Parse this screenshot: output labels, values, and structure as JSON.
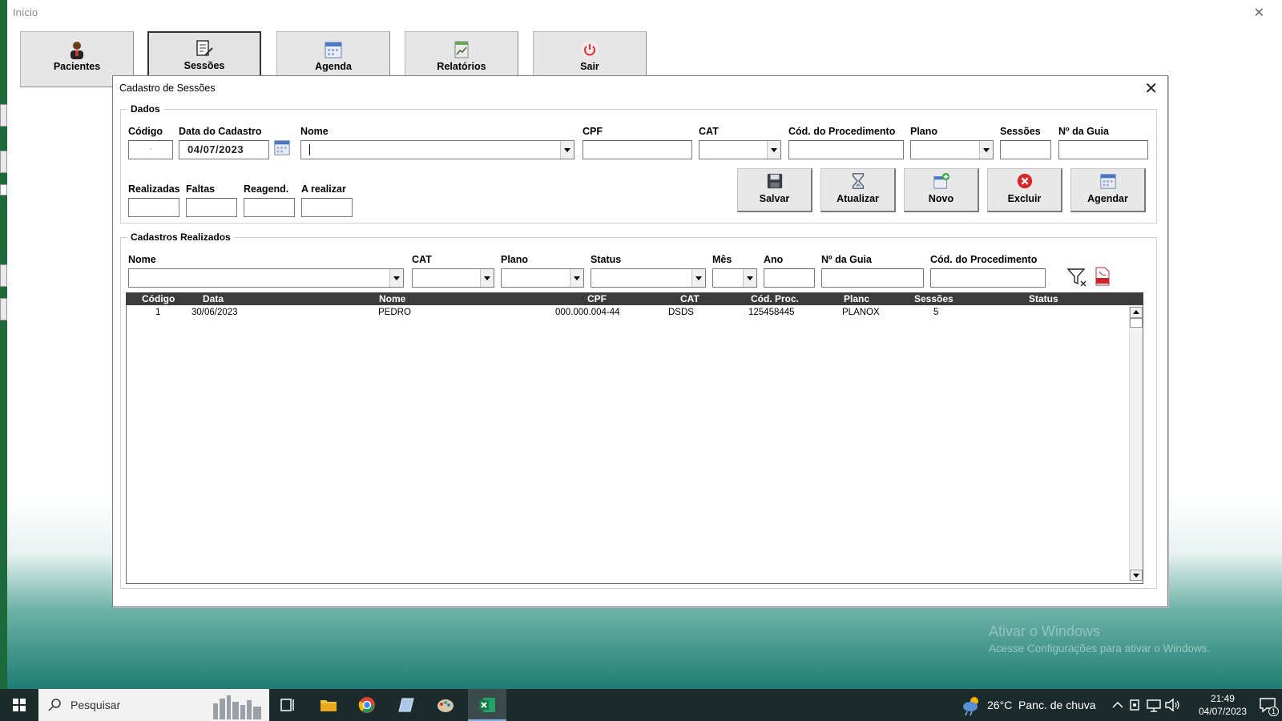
{
  "window": {
    "title": "Início"
  },
  "top_nav": [
    {
      "label": "Pacientes",
      "icon": "person-icon"
    },
    {
      "label": "Sessões",
      "icon": "edit-document-icon"
    },
    {
      "label": "Agenda",
      "icon": "calendar-icon"
    },
    {
      "label": "Relatórios",
      "icon": "report-chart-icon"
    },
    {
      "label": "Sair",
      "icon": "power-icon"
    }
  ],
  "dialog": {
    "title": "Cadastro de Sessões",
    "dados": {
      "legend": "Dados",
      "codigo_label": "Código",
      "codigo_value": "-",
      "data_label": "Data do Cadastro",
      "data_value": "04/07/2023",
      "nome_label": "Nome",
      "nome_value": "",
      "cpf_label": "CPF",
      "cat_label": "CAT",
      "cod_proc_label": "Cód. do Procedimento",
      "plano_label": "Plano",
      "sessoes_label": "Sessões",
      "guia_label": "Nº da Guia",
      "realizadas_label": "Realizadas",
      "faltas_label": "Faltas",
      "reagend_label": "Reagend.",
      "a_realizar_label": "A realizar"
    },
    "actions": [
      {
        "label": "Salvar",
        "icon": "save-icon"
      },
      {
        "label": "Atualizar",
        "icon": "hourglass-icon"
      },
      {
        "label": "Novo",
        "icon": "new-document-icon"
      },
      {
        "label": "Excluir",
        "icon": "delete-icon"
      },
      {
        "label": "Agendar",
        "icon": "calendar-icon"
      }
    ],
    "cadastros": {
      "legend": "Cadastros Realizados",
      "filters": {
        "nome": "Nome",
        "cat": "CAT",
        "plano": "Plano",
        "status": "Status",
        "mes": "Mês",
        "ano": "Ano",
        "guia": "Nº da Guia",
        "cod_proc": "Cód. do Procedimento"
      },
      "columns": [
        "Código",
        "Data",
        "Nome",
        "CPF",
        "CAT",
        "Cód. Proc.",
        "Planc",
        "Sessões",
        "Status"
      ],
      "rows": [
        [
          "1",
          "30/06/2023",
          "PEDRO",
          "000.000.004-44",
          "DSDS",
          "125458445",
          "PLANOX",
          "5",
          ""
        ]
      ]
    }
  },
  "watermark": {
    "line1": "Ativar o Windows",
    "line2": "Acesse Configurações para ativar o Windows."
  },
  "taskbar": {
    "search_placeholder": "Pesquisar",
    "weather": "26°C  Panc. de chuva",
    "time": "21:49",
    "date": "04/07/2023",
    "notifications": "1"
  }
}
